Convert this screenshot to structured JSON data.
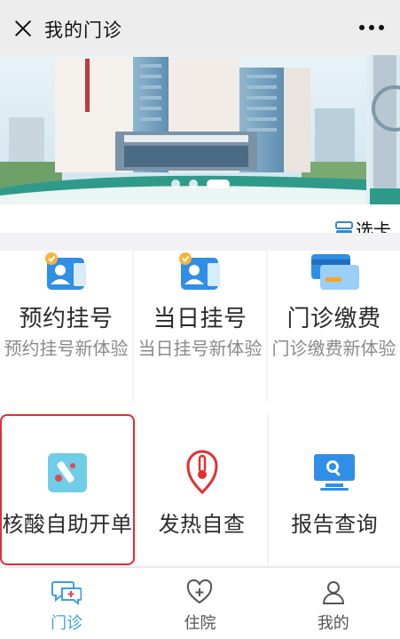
{
  "header": {
    "title": "我的门诊",
    "close_icon": "close-icon",
    "more_icon": "more-icon"
  },
  "banner": {
    "dots_total": 3,
    "active_dot": 2
  },
  "tab_switch": {
    "label": "选卡",
    "icon": "card-switch-icon"
  },
  "services_row1": [
    {
      "title": "预约挂号",
      "subtitle": "预约挂号新体验",
      "icon": "appointment-registration-icon"
    },
    {
      "title": "当日挂号",
      "subtitle": "当日挂号新体验",
      "icon": "same-day-registration-icon"
    },
    {
      "title": "门诊缴费",
      "subtitle": "门诊缴费新体验",
      "icon": "outpatient-payment-icon"
    }
  ],
  "services_row2": [
    {
      "title": "核酸自助开单",
      "icon": "nucleic-acid-test-icon",
      "selected": true
    },
    {
      "title": "发热自查",
      "icon": "thermometer-icon"
    },
    {
      "title": "报告查询",
      "icon": "report-search-icon"
    }
  ],
  "tabbar": [
    {
      "label": "门诊",
      "icon": "chat-plus-icon",
      "active": true
    },
    {
      "label": "住院",
      "icon": "heart-plus-icon"
    },
    {
      "label": "我的",
      "icon": "user-icon"
    }
  ],
  "colors": {
    "accent": "#3aa0e6",
    "selection": "#d9303a",
    "header_bg": "#ededed",
    "grid_bg": "#f2f2f4"
  }
}
